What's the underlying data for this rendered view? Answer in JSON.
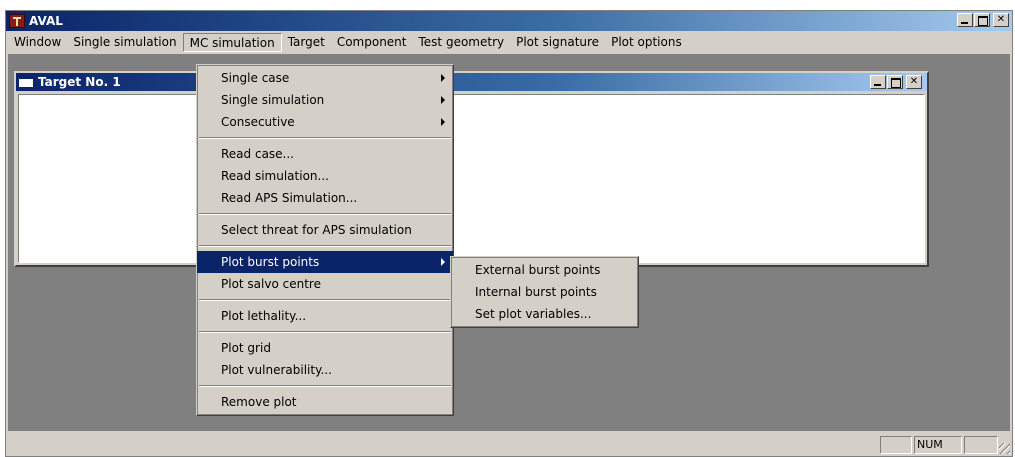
{
  "app": {
    "title": "AVAL"
  },
  "menubar": {
    "items": [
      {
        "label": "Window"
      },
      {
        "label": "Single simulation"
      },
      {
        "label": "MC simulation"
      },
      {
        "label": "Target"
      },
      {
        "label": "Component"
      },
      {
        "label": "Test geometry"
      },
      {
        "label": "Plot signature"
      },
      {
        "label": "Plot options"
      }
    ]
  },
  "child_window": {
    "title": "Target No. 1"
  },
  "mc_menu": {
    "items": [
      {
        "label": "Single case",
        "submenu": true
      },
      {
        "label": "Single simulation",
        "submenu": true
      },
      {
        "label": "Consecutive",
        "submenu": true
      },
      {
        "label": "Read case..."
      },
      {
        "label": "Read simulation..."
      },
      {
        "label": "Read APS Simulation..."
      },
      {
        "label": "Select threat for APS simulation"
      },
      {
        "label": "Plot burst points",
        "submenu": true,
        "highlighted": true
      },
      {
        "label": "Plot salvo centre"
      },
      {
        "label": "Plot lethality..."
      },
      {
        "label": "Plot grid"
      },
      {
        "label": "Plot vulnerability..."
      },
      {
        "label": "Remove plot"
      }
    ]
  },
  "burst_submenu": {
    "items": [
      {
        "label": "External burst points"
      },
      {
        "label": "Internal burst points"
      },
      {
        "label": "Set plot variables..."
      }
    ]
  },
  "statusbar": {
    "num_label": "NUM"
  },
  "colors": {
    "selection": "#0a246a",
    "face": "#d4d0c8",
    "mdi_background": "#808080"
  }
}
